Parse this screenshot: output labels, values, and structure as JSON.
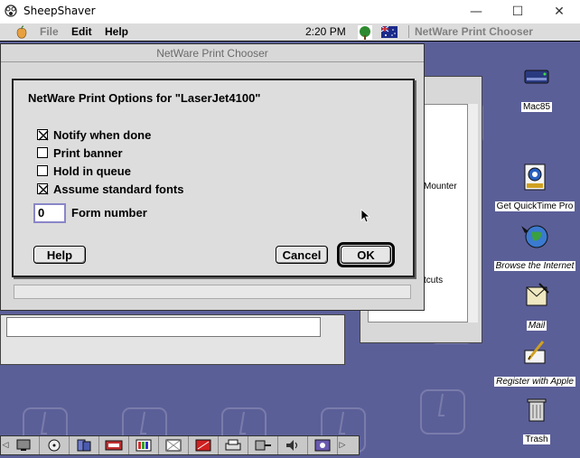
{
  "host": {
    "title": "SheepShaver",
    "minimize": "—",
    "maximize": "☐",
    "close": "✕"
  },
  "menubar": {
    "file": "File",
    "edit": "Edit",
    "help": "Help",
    "clock": "2:20 PM",
    "app_name": "NetWare Print Chooser"
  },
  "chooser_window": {
    "title": "NetWare Print Chooser"
  },
  "background_window": {
    "text_mounter": "Mounter",
    "text_shortcuts": "tcuts"
  },
  "dialog": {
    "title": "NetWare Print Options for \"LaserJet4100\"",
    "options": [
      {
        "label": "Notify when done",
        "checked": true
      },
      {
        "label": "Print banner",
        "checked": false
      },
      {
        "label": "Hold in queue",
        "checked": false
      },
      {
        "label": "Assume standard fonts",
        "checked": true
      }
    ],
    "form_number_value": "0",
    "form_number_label": "Form number",
    "help_button": "Help",
    "cancel_button": "Cancel",
    "ok_button": "OK"
  },
  "desktop_icons": [
    {
      "label": "Mac85",
      "icon": "hard-drive-icon"
    },
    {
      "label": "Get QuickTime Pro",
      "icon": "quicktime-icon"
    },
    {
      "label": "Browse the Internet",
      "icon": "globe-icon"
    },
    {
      "label": "Mail",
      "icon": "mail-icon"
    },
    {
      "label": "Register with Apple",
      "icon": "register-icon"
    },
    {
      "label": "Trash",
      "icon": "trash-icon"
    }
  ]
}
